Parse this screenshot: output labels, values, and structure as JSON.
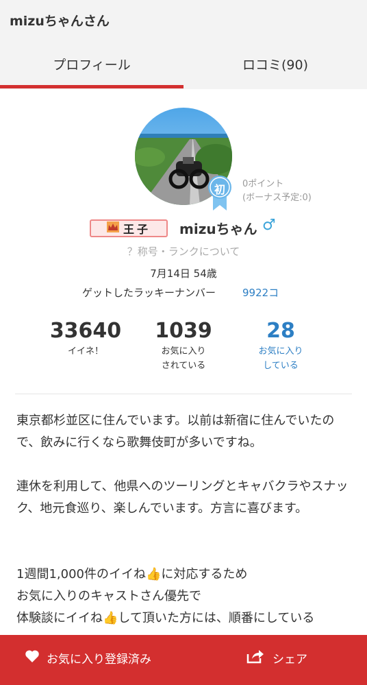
{
  "header": {
    "title": "mizuちゃんさん"
  },
  "tabs": [
    {
      "label": "プロフィール"
    },
    {
      "label": "ロコミ(90)"
    }
  ],
  "profile": {
    "badge_first": "初",
    "points": "0ポイント",
    "bonus": "(ボーナス予定:0)",
    "rank_title": "王子",
    "username": "mizuちゃん",
    "gender_symbol": "♂",
    "rank_link": "？称号・ランクについて",
    "birthday": "7月14日 54歳",
    "lucky_label": "ゲットしたラッキーナンバー",
    "lucky_value": "9922コ"
  },
  "stats": [
    {
      "value": "33640",
      "label_1": "イイネ！",
      "label_2": ""
    },
    {
      "value": "1039",
      "label_1": "お気に入り",
      "label_2": "されている"
    },
    {
      "value": "28",
      "label_1": "お気に入り",
      "label_2": "している"
    }
  ],
  "bio": {
    "p1": "東京都杉並区に住んでいます。以前は新宿に住んでいたので、飲みに行くなら歌舞伎町が多いですね。",
    "p2": "連休を利用して、他県へのツーリングとキャバクラやスナック、地元食巡り、楽しんでいます。方言に喜びます。",
    "p3a": "1週間1,000件のイイね",
    "p3b": "に対応するため",
    "p4": "お気に入りのキャストさん優先で",
    "p5": "体験談にイイね👍して頂いた方には、順番にしている"
  },
  "footer": {
    "favorite_label": "お気に入り登録済み",
    "share_label": "シェア"
  },
  "colors": {
    "accent": "#d32f2f",
    "link": "#2d7fc4",
    "gender": "#3aa3d9"
  }
}
